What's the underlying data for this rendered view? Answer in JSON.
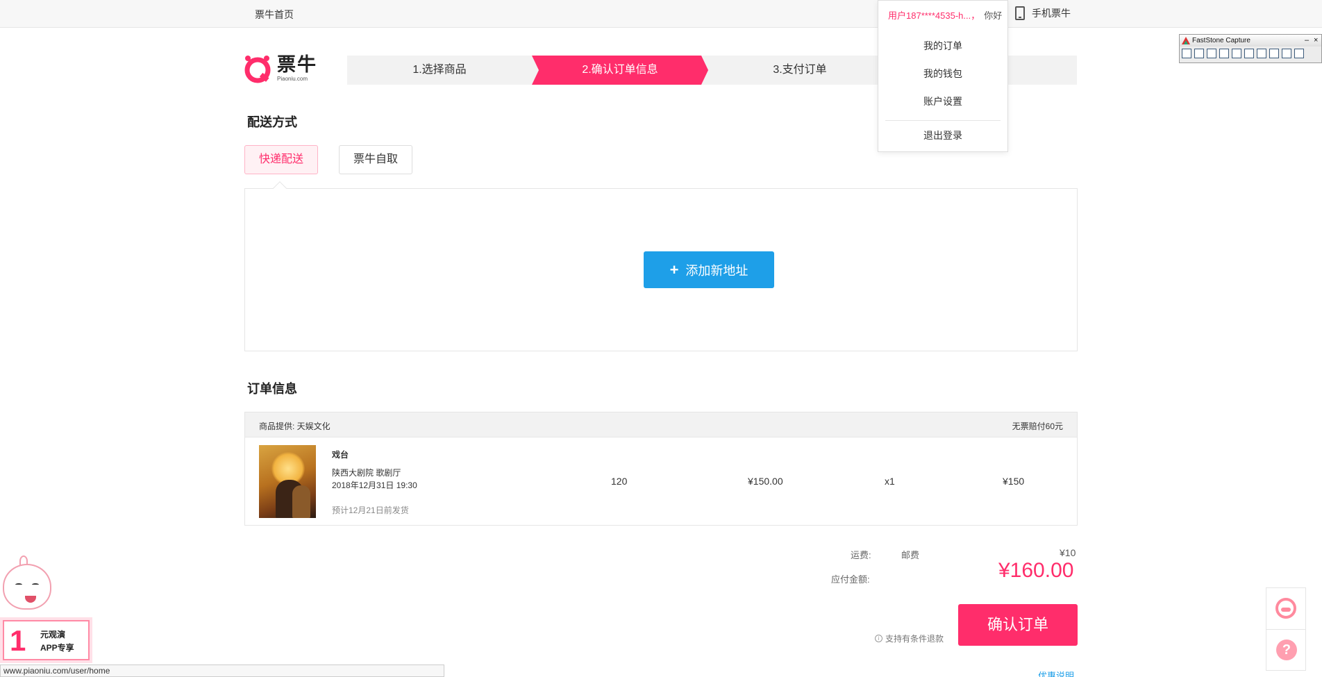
{
  "topbar": {
    "home_link": "票牛首页",
    "mobile_label": "手机票牛"
  },
  "user_menu": {
    "username": "用户187****4535-h...，",
    "greeting": "你好",
    "items": [
      {
        "label": "我的订单"
      },
      {
        "label": "我的钱包"
      },
      {
        "label": "账户设置"
      },
      {
        "label": "退出登录"
      }
    ]
  },
  "faststone": {
    "title": "FastStone Capture",
    "minimize": "–",
    "close": "×"
  },
  "logo": {
    "cn": "票牛",
    "en": "Piaoniu.com"
  },
  "steps": [
    {
      "label": "1.选择商品",
      "active": false
    },
    {
      "label": "2.确认订单信息",
      "active": true
    },
    {
      "label": "3.支付订单",
      "active": false
    }
  ],
  "delivery": {
    "title": "配送方式",
    "tabs": [
      {
        "label": "快递配送",
        "selected": true
      },
      {
        "label": "票牛自取",
        "selected": false
      }
    ],
    "add_address_button": "添加新地址"
  },
  "order": {
    "title": "订单信息",
    "provider": "商品提供: 天娱文化",
    "compensation": "无票赔付60元",
    "item": {
      "name": "戏台",
      "venue": "陕西大剧院 歌剧厅",
      "datetime": "2018年12月31日 19:30",
      "shipping_note": "预计12月21日前发货",
      "ticket_price": "120",
      "unit_price": "¥150.00",
      "quantity": "x1",
      "subtotal": "¥150"
    }
  },
  "summary": {
    "shipping_label": "运费:",
    "shipping_type": "邮费",
    "shipping_value": "¥10",
    "total_label": "应付金额:",
    "total_value": "¥160.00",
    "refund_note": "支持有条件退款",
    "confirm_button": "确认订单",
    "discount_link": "优惠说明"
  },
  "promo": {
    "number": "1",
    "line1": "元观演",
    "line2": "APP专享"
  },
  "status_bar": {
    "url": "www.piaoniu.com/user/home"
  },
  "colors": {
    "accent": "#ff2d6b",
    "button_blue": "#1e9fe8"
  }
}
